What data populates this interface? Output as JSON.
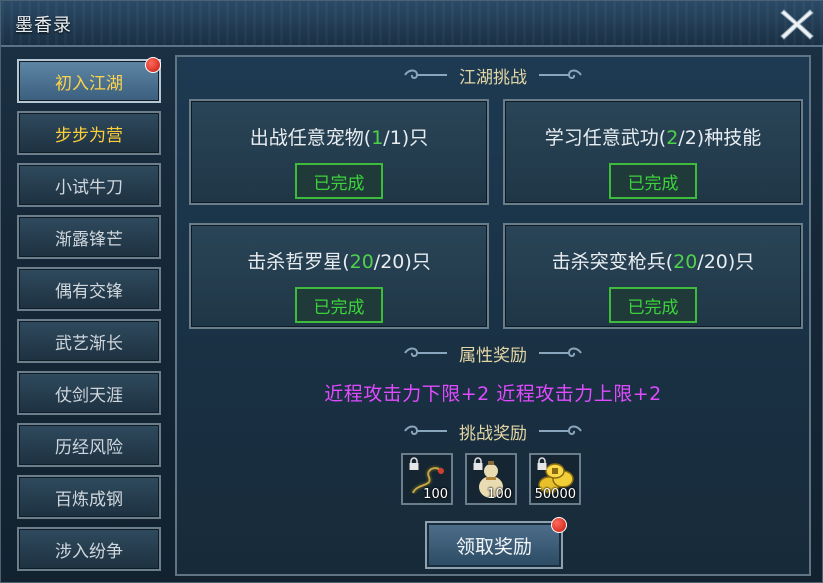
{
  "window": {
    "title": "墨香录",
    "close_icon": "close-x-icon"
  },
  "sidebar": {
    "items": [
      {
        "label": "初入江湖",
        "state": "active",
        "badge": true
      },
      {
        "label": "步步为营",
        "state": "current",
        "badge": false
      },
      {
        "label": "小试牛刀",
        "state": "normal",
        "badge": false
      },
      {
        "label": "渐露锋芒",
        "state": "normal",
        "badge": false
      },
      {
        "label": "偶有交锋",
        "state": "normal",
        "badge": false
      },
      {
        "label": "武艺渐长",
        "state": "normal",
        "badge": false
      },
      {
        "label": "仗剑天涯",
        "state": "normal",
        "badge": false
      },
      {
        "label": "历经风险",
        "state": "normal",
        "badge": false
      },
      {
        "label": "百炼成钢",
        "state": "normal",
        "badge": false
      },
      {
        "label": "涉入纷争",
        "state": "normal",
        "badge": false
      }
    ]
  },
  "challenge": {
    "title": "江湖挑战",
    "tasks": [
      {
        "prefix": "出战任意宠物(",
        "progress": "1",
        "suffix": "/1)只",
        "status": "已完成"
      },
      {
        "prefix": "学习任意武功(",
        "progress": "2",
        "suffix": "/2)种技能",
        "status": "已完成"
      },
      {
        "prefix": "击杀哲罗星(",
        "progress": "20",
        "suffix": "/20)只",
        "status": "已完成"
      },
      {
        "prefix": "击杀突变枪兵(",
        "progress": "20",
        "suffix": "/20)只",
        "status": "已完成"
      }
    ]
  },
  "attribute_reward": {
    "title": "属性奖励",
    "text": "近程攻击力下限+2  近程攻击力上限+2"
  },
  "challenge_reward": {
    "title": "挑战奖励",
    "items": [
      {
        "icon": "dragon-whip-item-icon",
        "quantity": "100",
        "locked": true
      },
      {
        "icon": "gourd-item-icon",
        "quantity": "100",
        "locked": true
      },
      {
        "icon": "gold-coins-item-icon",
        "quantity": "50000",
        "locked": true
      }
    ]
  },
  "claim_button": {
    "label": "领取奖励",
    "badge": true
  },
  "colors": {
    "progress_green": "#4ed24a",
    "done_green": "#3bd33a",
    "attr_magenta": "#e04bff",
    "active_gold": "#ffd34a",
    "badge_red": "#c51a12"
  }
}
